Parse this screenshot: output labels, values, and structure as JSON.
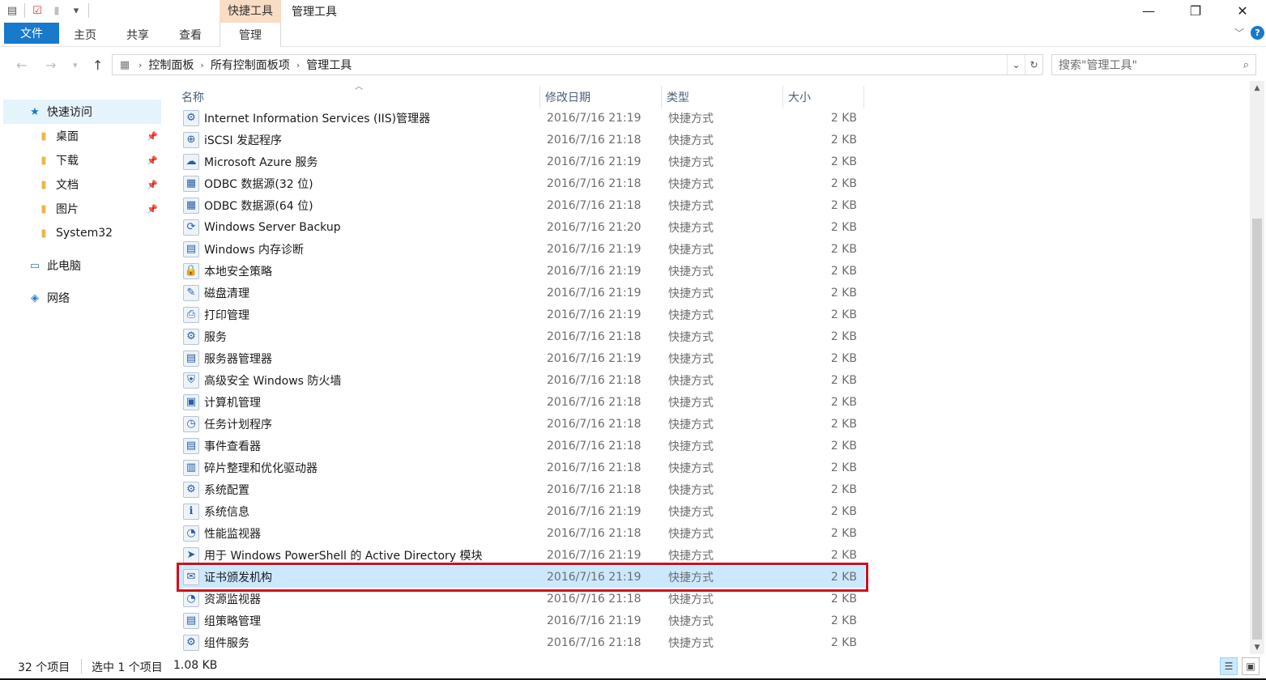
{
  "titlebar": {
    "context_tab": "快捷工具",
    "title": "管理工具",
    "qat_icons": [
      "properties-icon",
      "checkmark-icon",
      "new-folder-icon",
      "customize-arrow-icon"
    ],
    "controls": {
      "minimize": "—",
      "maximize": "❐",
      "close": "✕"
    }
  },
  "ribbon": {
    "file": "文件",
    "tabs": [
      "主页",
      "共享",
      "查看"
    ],
    "active_tab": "管理",
    "accent": "#1979ca"
  },
  "address": {
    "crumbs": [
      "控制面板",
      "所有控制面板项",
      "管理工具"
    ],
    "search_placeholder": "搜索\"管理工具\""
  },
  "nav": {
    "quick_access": "快速访问",
    "items": [
      {
        "label": "桌面",
        "icon": "desktop-folder-icon",
        "pinned": true
      },
      {
        "label": "下载",
        "icon": "download-folder-icon",
        "pinned": true
      },
      {
        "label": "文档",
        "icon": "documents-folder-icon",
        "pinned": true
      },
      {
        "label": "图片",
        "icon": "pictures-folder-icon",
        "pinned": true
      },
      {
        "label": "System32",
        "icon": "folder-icon",
        "pinned": false
      }
    ],
    "this_pc": "此电脑",
    "network": "网络"
  },
  "columns": {
    "name": "名称",
    "date": "修改日期",
    "type": "类型",
    "size": "大小"
  },
  "files": [
    {
      "name": "Internet Information Services (IIS)管理器",
      "date": "2016/7/16 21:19",
      "type": "快捷方式",
      "size": "2 KB"
    },
    {
      "name": "iSCSI 发起程序",
      "date": "2016/7/16 21:18",
      "type": "快捷方式",
      "size": "2 KB"
    },
    {
      "name": "Microsoft Azure 服务",
      "date": "2016/7/16 21:19",
      "type": "快捷方式",
      "size": "2 KB"
    },
    {
      "name": "ODBC 数据源(32 位)",
      "date": "2016/7/16 21:18",
      "type": "快捷方式",
      "size": "2 KB"
    },
    {
      "name": "ODBC 数据源(64 位)",
      "date": "2016/7/16 21:18",
      "type": "快捷方式",
      "size": "2 KB"
    },
    {
      "name": "Windows Server Backup",
      "date": "2016/7/16 21:20",
      "type": "快捷方式",
      "size": "2 KB"
    },
    {
      "name": "Windows 内存诊断",
      "date": "2016/7/16 21:19",
      "type": "快捷方式",
      "size": "2 KB"
    },
    {
      "name": "本地安全策略",
      "date": "2016/7/16 21:19",
      "type": "快捷方式",
      "size": "2 KB"
    },
    {
      "name": "磁盘清理",
      "date": "2016/7/16 21:19",
      "type": "快捷方式",
      "size": "2 KB"
    },
    {
      "name": "打印管理",
      "date": "2016/7/16 21:19",
      "type": "快捷方式",
      "size": "2 KB"
    },
    {
      "name": "服务",
      "date": "2016/7/16 21:18",
      "type": "快捷方式",
      "size": "2 KB"
    },
    {
      "name": "服务器管理器",
      "date": "2016/7/16 21:19",
      "type": "快捷方式",
      "size": "2 KB"
    },
    {
      "name": "高级安全 Windows 防火墙",
      "date": "2016/7/16 21:18",
      "type": "快捷方式",
      "size": "2 KB"
    },
    {
      "name": "计算机管理",
      "date": "2016/7/16 21:18",
      "type": "快捷方式",
      "size": "2 KB"
    },
    {
      "name": "任务计划程序",
      "date": "2016/7/16 21:18",
      "type": "快捷方式",
      "size": "2 KB"
    },
    {
      "name": "事件查看器",
      "date": "2016/7/16 21:18",
      "type": "快捷方式",
      "size": "2 KB"
    },
    {
      "name": "碎片整理和优化驱动器",
      "date": "2016/7/16 21:18",
      "type": "快捷方式",
      "size": "2 KB"
    },
    {
      "name": "系统配置",
      "date": "2016/7/16 21:18",
      "type": "快捷方式",
      "size": "2 KB"
    },
    {
      "name": "系统信息",
      "date": "2016/7/16 21:19",
      "type": "快捷方式",
      "size": "2 KB"
    },
    {
      "name": "性能监视器",
      "date": "2016/7/16 21:18",
      "type": "快捷方式",
      "size": "2 KB"
    },
    {
      "name": "用于 Windows PowerShell 的 Active Directory 模块",
      "date": "2016/7/16 21:19",
      "type": "快捷方式",
      "size": "2 KB"
    },
    {
      "name": "证书颁发机构",
      "date": "2016/7/16 21:19",
      "type": "快捷方式",
      "size": "2 KB",
      "selected": true
    },
    {
      "name": "资源监视器",
      "date": "2016/7/16 21:18",
      "type": "快捷方式",
      "size": "2 KB"
    },
    {
      "name": "组策略管理",
      "date": "2016/7/16 21:19",
      "type": "快捷方式",
      "size": "2 KB"
    },
    {
      "name": "组件服务",
      "date": "2016/7/16 21:18",
      "type": "快捷方式",
      "size": "2 KB"
    }
  ],
  "status": {
    "count": "32 个项目",
    "selection": "选中 1 个项目",
    "size": "1.08 KB"
  },
  "colors": {
    "selection": "#cce8ff",
    "highlight_border": "#d00f1c",
    "context_tab": "#f9dcc4"
  }
}
